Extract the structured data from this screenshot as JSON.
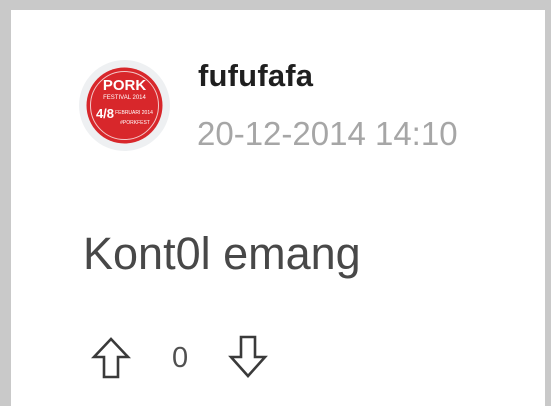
{
  "comment": {
    "author": "fufufafa",
    "timestamp": "20-12-2014 14:10",
    "text": "Kont0l emang",
    "avatar": {
      "icon": "pork-festival-2014-logo",
      "text_lines": [
        "PORK",
        "FESTIVAL 2014",
        "4/8",
        "FEBRUARI 2014",
        "#PORKFEST"
      ],
      "colors": {
        "background": "#eef0f2",
        "circle": "#d8272b",
        "text": "#ffffff"
      }
    },
    "votes": {
      "count": "0",
      "upvote_icon": "arrow-up-outline-icon",
      "downvote_icon": "arrow-down-outline-icon"
    }
  },
  "colors": {
    "page_bg": "#c9c9c9",
    "card_bg": "#ffffff",
    "author": "#1f1f1f",
    "timestamp": "#a6a6a6",
    "body": "#484848",
    "icons": "#3a3a3a"
  }
}
